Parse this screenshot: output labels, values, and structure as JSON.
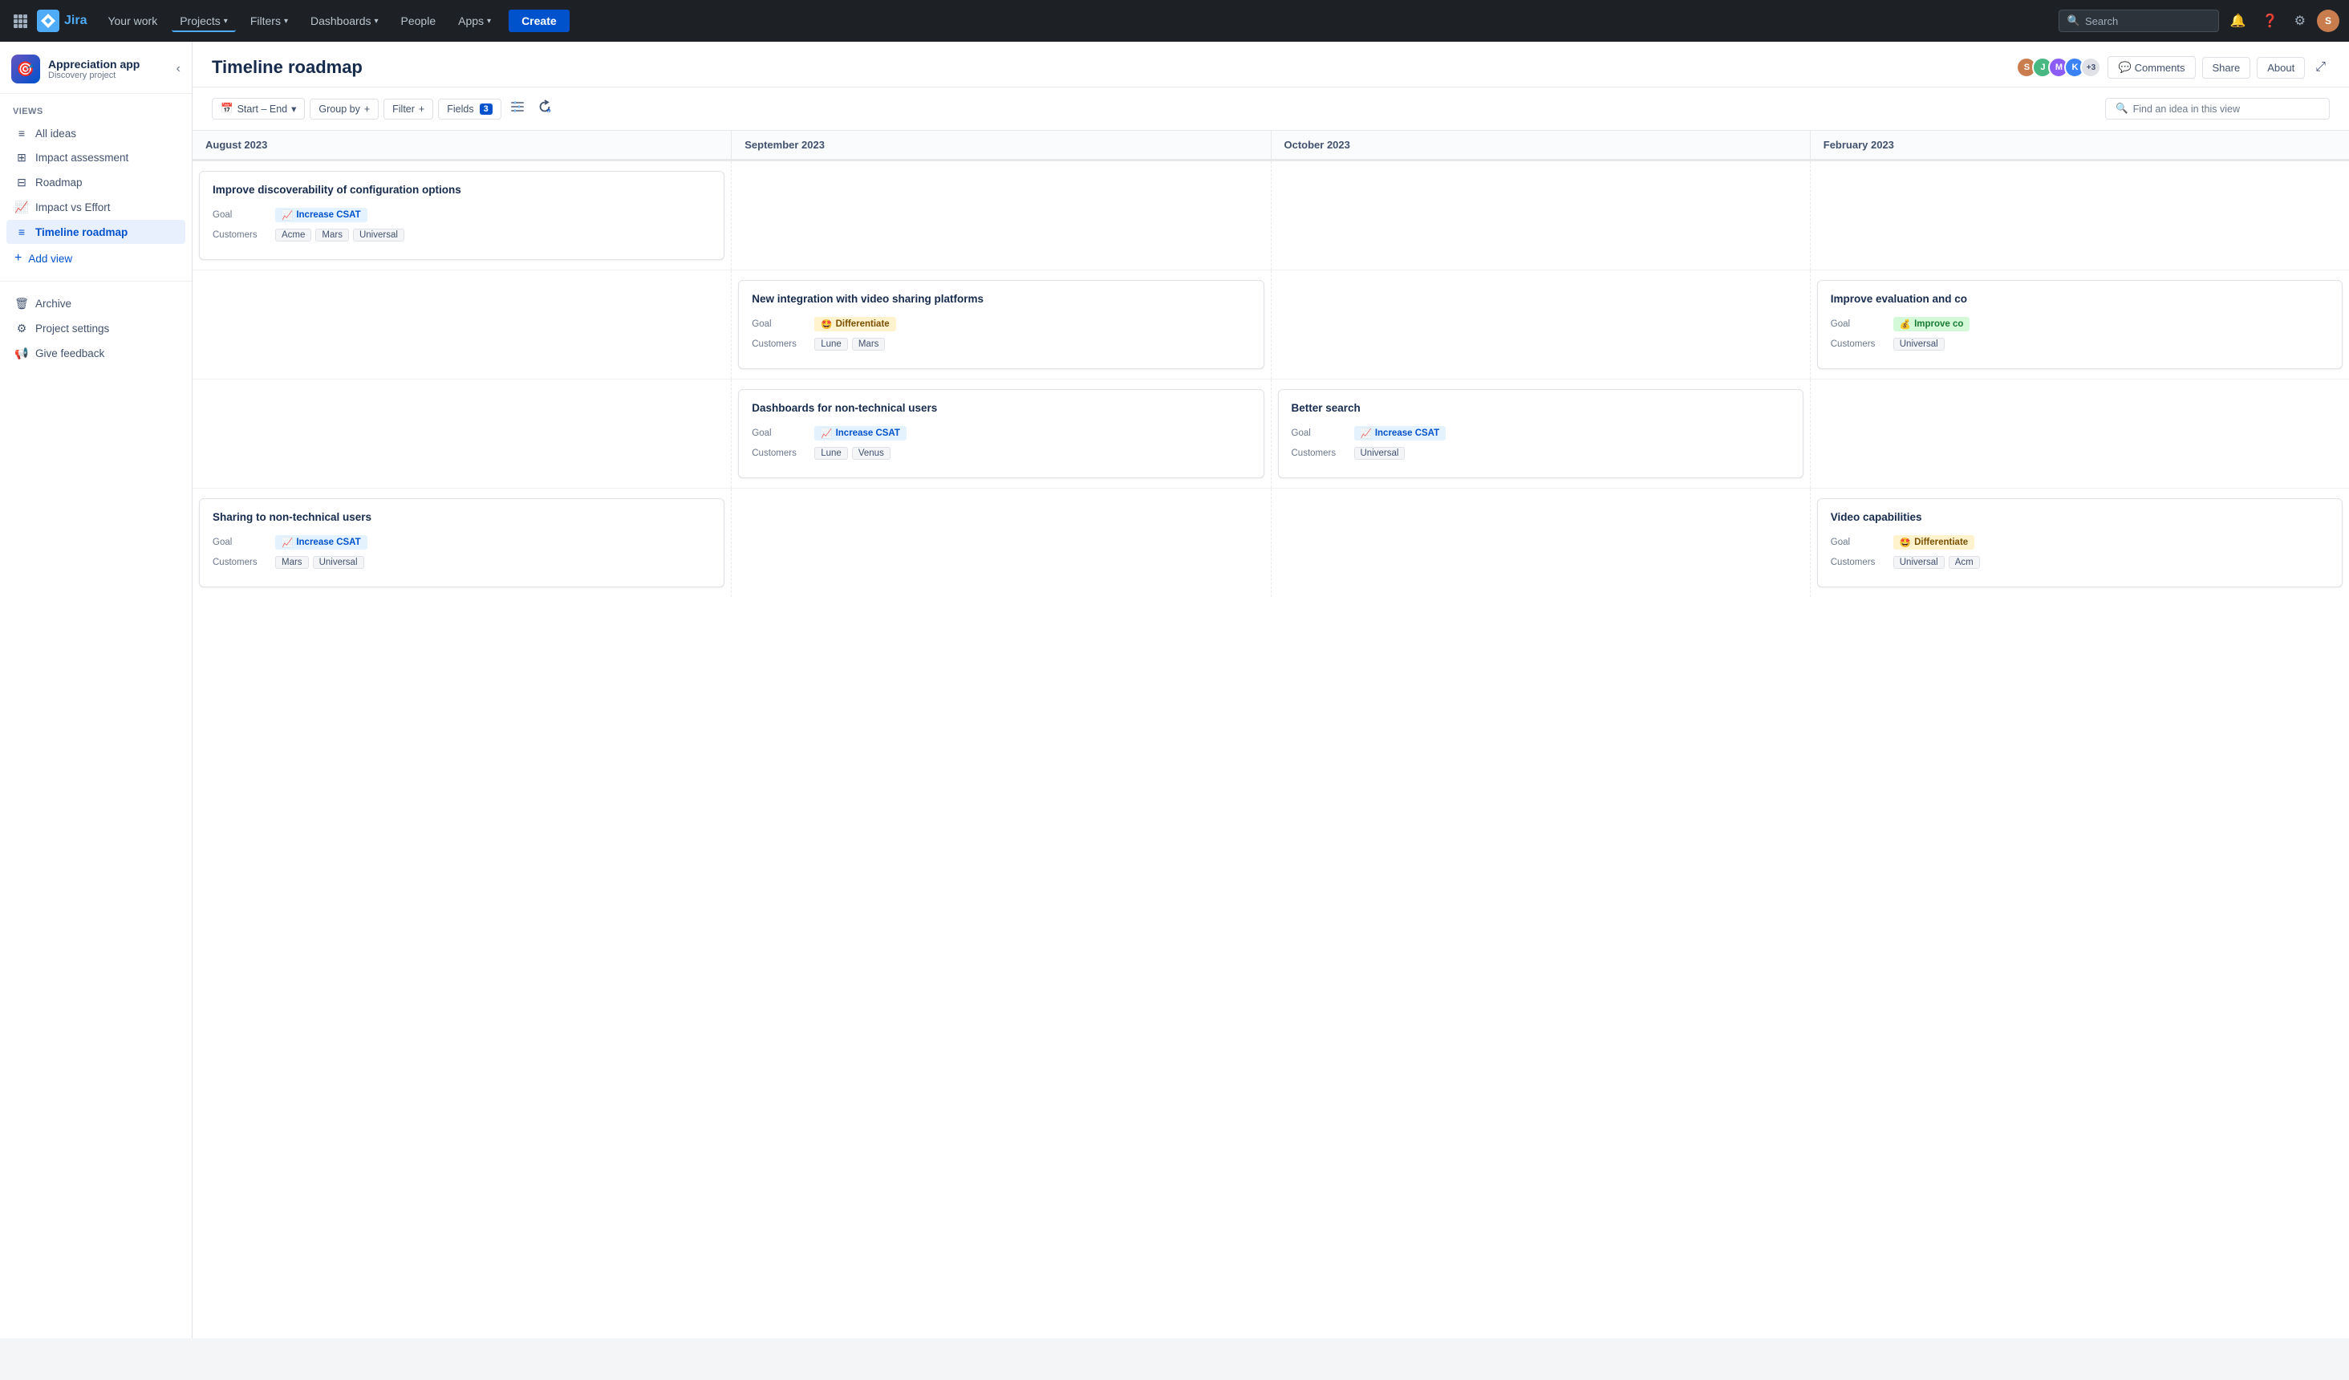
{
  "nav": {
    "logo_text": "Jira",
    "items": [
      {
        "label": "Your work",
        "has_dropdown": false
      },
      {
        "label": "Projects",
        "has_dropdown": true
      },
      {
        "label": "Filters",
        "has_dropdown": true
      },
      {
        "label": "Dashboards",
        "has_dropdown": true
      },
      {
        "label": "People",
        "has_dropdown": false
      },
      {
        "label": "Apps",
        "has_dropdown": true
      }
    ],
    "create_label": "Create",
    "search_placeholder": "Search"
  },
  "sidebar": {
    "project_icon": "🎯",
    "project_name": "Appreciation app",
    "project_type": "Discovery project",
    "views_label": "VIEWS",
    "add_view_label": "Add view",
    "nav_items": [
      {
        "id": "all-ideas",
        "icon": "≡",
        "label": "All ideas",
        "active": false
      },
      {
        "id": "impact-assessment",
        "icon": "⊞",
        "label": "Impact assessment",
        "active": false
      },
      {
        "id": "roadmap",
        "icon": "⊟",
        "label": "Roadmap",
        "active": false
      },
      {
        "id": "impact-vs-effort",
        "icon": "📈",
        "label": "Impact vs Effort",
        "active": false
      },
      {
        "id": "timeline-roadmap",
        "icon": "≡",
        "label": "Timeline roadmap",
        "active": true
      }
    ],
    "bottom_items": [
      {
        "id": "archive",
        "icon": "🗑",
        "label": "Archive"
      },
      {
        "id": "project-settings",
        "icon": "⚙",
        "label": "Project settings"
      },
      {
        "id": "give-feedback",
        "icon": "📢",
        "label": "Give feedback"
      }
    ]
  },
  "page": {
    "title": "Timeline roadmap",
    "avatars": [
      {
        "color": "#c97d4e",
        "initials": "S"
      },
      {
        "color": "#47b881",
        "initials": "J"
      },
      {
        "color": "#8b5cf6",
        "initials": "M"
      },
      {
        "color": "#3b82f6",
        "initials": "K"
      },
      {
        "count": "+3"
      }
    ],
    "header_buttons": [
      "Comments",
      "Share",
      "About"
    ],
    "toolbar": {
      "date_range": "Start – End",
      "group_by": "Group by",
      "filter": "Filter",
      "fields_label": "Fields",
      "fields_count": "3",
      "search_placeholder": "Find an idea in this view"
    }
  },
  "timeline": {
    "months": [
      "August 2023",
      "September 2023",
      "October 2023",
      "February 2023"
    ]
  },
  "ideas": [
    {
      "id": "idea-1",
      "title": "Improve discoverability of configuration options",
      "goal_emoji": "📈",
      "goal_label": "Increase CSAT",
      "goal_type": "csat",
      "customers": [
        "Acme",
        "Mars",
        "Universal"
      ],
      "col_start": 0,
      "col_end": 1,
      "row": 0
    },
    {
      "id": "idea-2",
      "title": "New integration with video sharing platforms",
      "goal_emoji": "🤩",
      "goal_label": "Differentiate",
      "goal_type": "differentiate",
      "customers": [
        "Lune",
        "Mars"
      ],
      "col_start": 1,
      "col_end": 2,
      "row": 1
    },
    {
      "id": "idea-3",
      "title": "Improve evaluation and co",
      "goal_emoji": "💰",
      "goal_label": "Improve co",
      "goal_type": "improve",
      "customers": [
        "Universal"
      ],
      "col_start": 3,
      "col_end": 4,
      "row": 1
    },
    {
      "id": "idea-4",
      "title": "Dashboards for non-technical users",
      "goal_emoji": "📈",
      "goal_label": "Increase CSAT",
      "goal_type": "csat",
      "customers": [
        "Lune",
        "Venus"
      ],
      "col_start": 1,
      "col_end": 2,
      "row": 2
    },
    {
      "id": "idea-5",
      "title": "Better search",
      "goal_emoji": "📈",
      "goal_label": "Increase CSAT",
      "goal_type": "csat",
      "customers": [
        "Universal"
      ],
      "col_start": 2,
      "col_end": 3,
      "row": 2
    },
    {
      "id": "idea-6",
      "title": "Sharing to non-technical users",
      "goal_emoji": "📈",
      "goal_label": "Increase CSAT",
      "goal_type": "csat",
      "customers": [
        "Mars",
        "Universal"
      ],
      "col_start": 0,
      "col_end": 1,
      "row": 3
    },
    {
      "id": "idea-7",
      "title": "Video capabilities",
      "goal_emoji": "🤩",
      "goal_label": "Differentiate",
      "goal_type": "differentiate",
      "customers": [
        "Universal",
        "Acm"
      ],
      "col_start": 3,
      "col_end": 4,
      "row": 3
    }
  ],
  "labels": {
    "goal": "Goal",
    "customers": "Customers"
  }
}
